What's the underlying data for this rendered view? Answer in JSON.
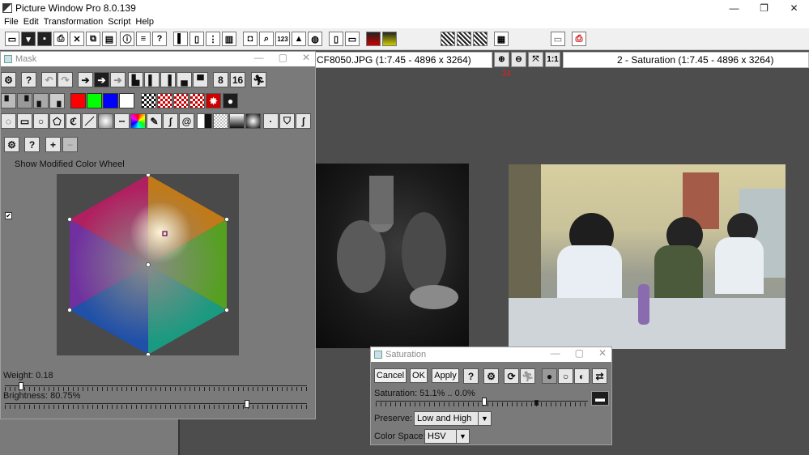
{
  "app": {
    "title": "Picture Window Pro 8.0.139"
  },
  "menu": [
    "File",
    "Edit",
    "Transformation",
    "Script",
    "Help"
  ],
  "toolbar": {
    "num_label": "123"
  },
  "documents": [
    {
      "title": "CF8050.JPG (1:7.45 - 4896 x 3264)"
    },
    {
      "title": "2 - Saturation (1:7.45 - 4896 x 3264)"
    }
  ],
  "zoom": {
    "label_1to1": "1:1",
    "level": "34"
  },
  "mask_panel": {
    "title": "Mask",
    "bit8": "8",
    "bit16": "16",
    "show_modified_label": "Show Modified Color Wheel",
    "show_modified_checked": true,
    "weight_label": "Weight: 0.18",
    "weight_value": 0.18,
    "brightness_label": "Brightness: 80.75%",
    "brightness_value": 0.8075,
    "swatch_colors": [
      "#ff0000",
      "#00ff00",
      "#0000ff",
      "#ffffff"
    ]
  },
  "saturation_panel": {
    "title": "Saturation",
    "cancel_label": "Cancel",
    "ok_label": "OK",
    "apply_label": "Apply",
    "saturation_label": "Saturation: 51.1% .. 0.0%",
    "saturation_value": 0.511,
    "preserve_label": "Preserve:",
    "preserve_value": "Low and High",
    "colorspace_label": "Color Space:",
    "colorspace_value": "HSV"
  }
}
